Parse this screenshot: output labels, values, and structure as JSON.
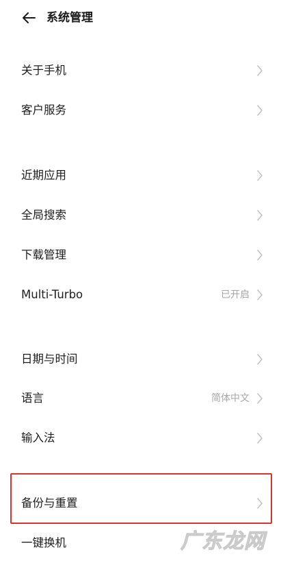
{
  "header": {
    "title": "系统管理",
    "back_icon": "arrow-left-icon"
  },
  "rows": {
    "about_phone": {
      "label": "关于手机"
    },
    "customer_service": {
      "label": "客户服务"
    },
    "recent_apps": {
      "label": "近期应用"
    },
    "global_search": {
      "label": "全局搜索"
    },
    "download_manager": {
      "label": "下载管理"
    },
    "multi_turbo": {
      "label": "Multi-Turbo",
      "value": "已开启"
    },
    "date_time": {
      "label": "日期与时间"
    },
    "language": {
      "label": "语言",
      "value": "简体中文"
    },
    "input_method": {
      "label": "输入法"
    },
    "backup_reset": {
      "label": "备份与重置"
    },
    "one_key_switch": {
      "label": "一键换机"
    }
  },
  "chevron_icon": "chevron-right-icon",
  "highlight_color": "#d9342b",
  "watermark": {
    "text": "广东龙网"
  }
}
